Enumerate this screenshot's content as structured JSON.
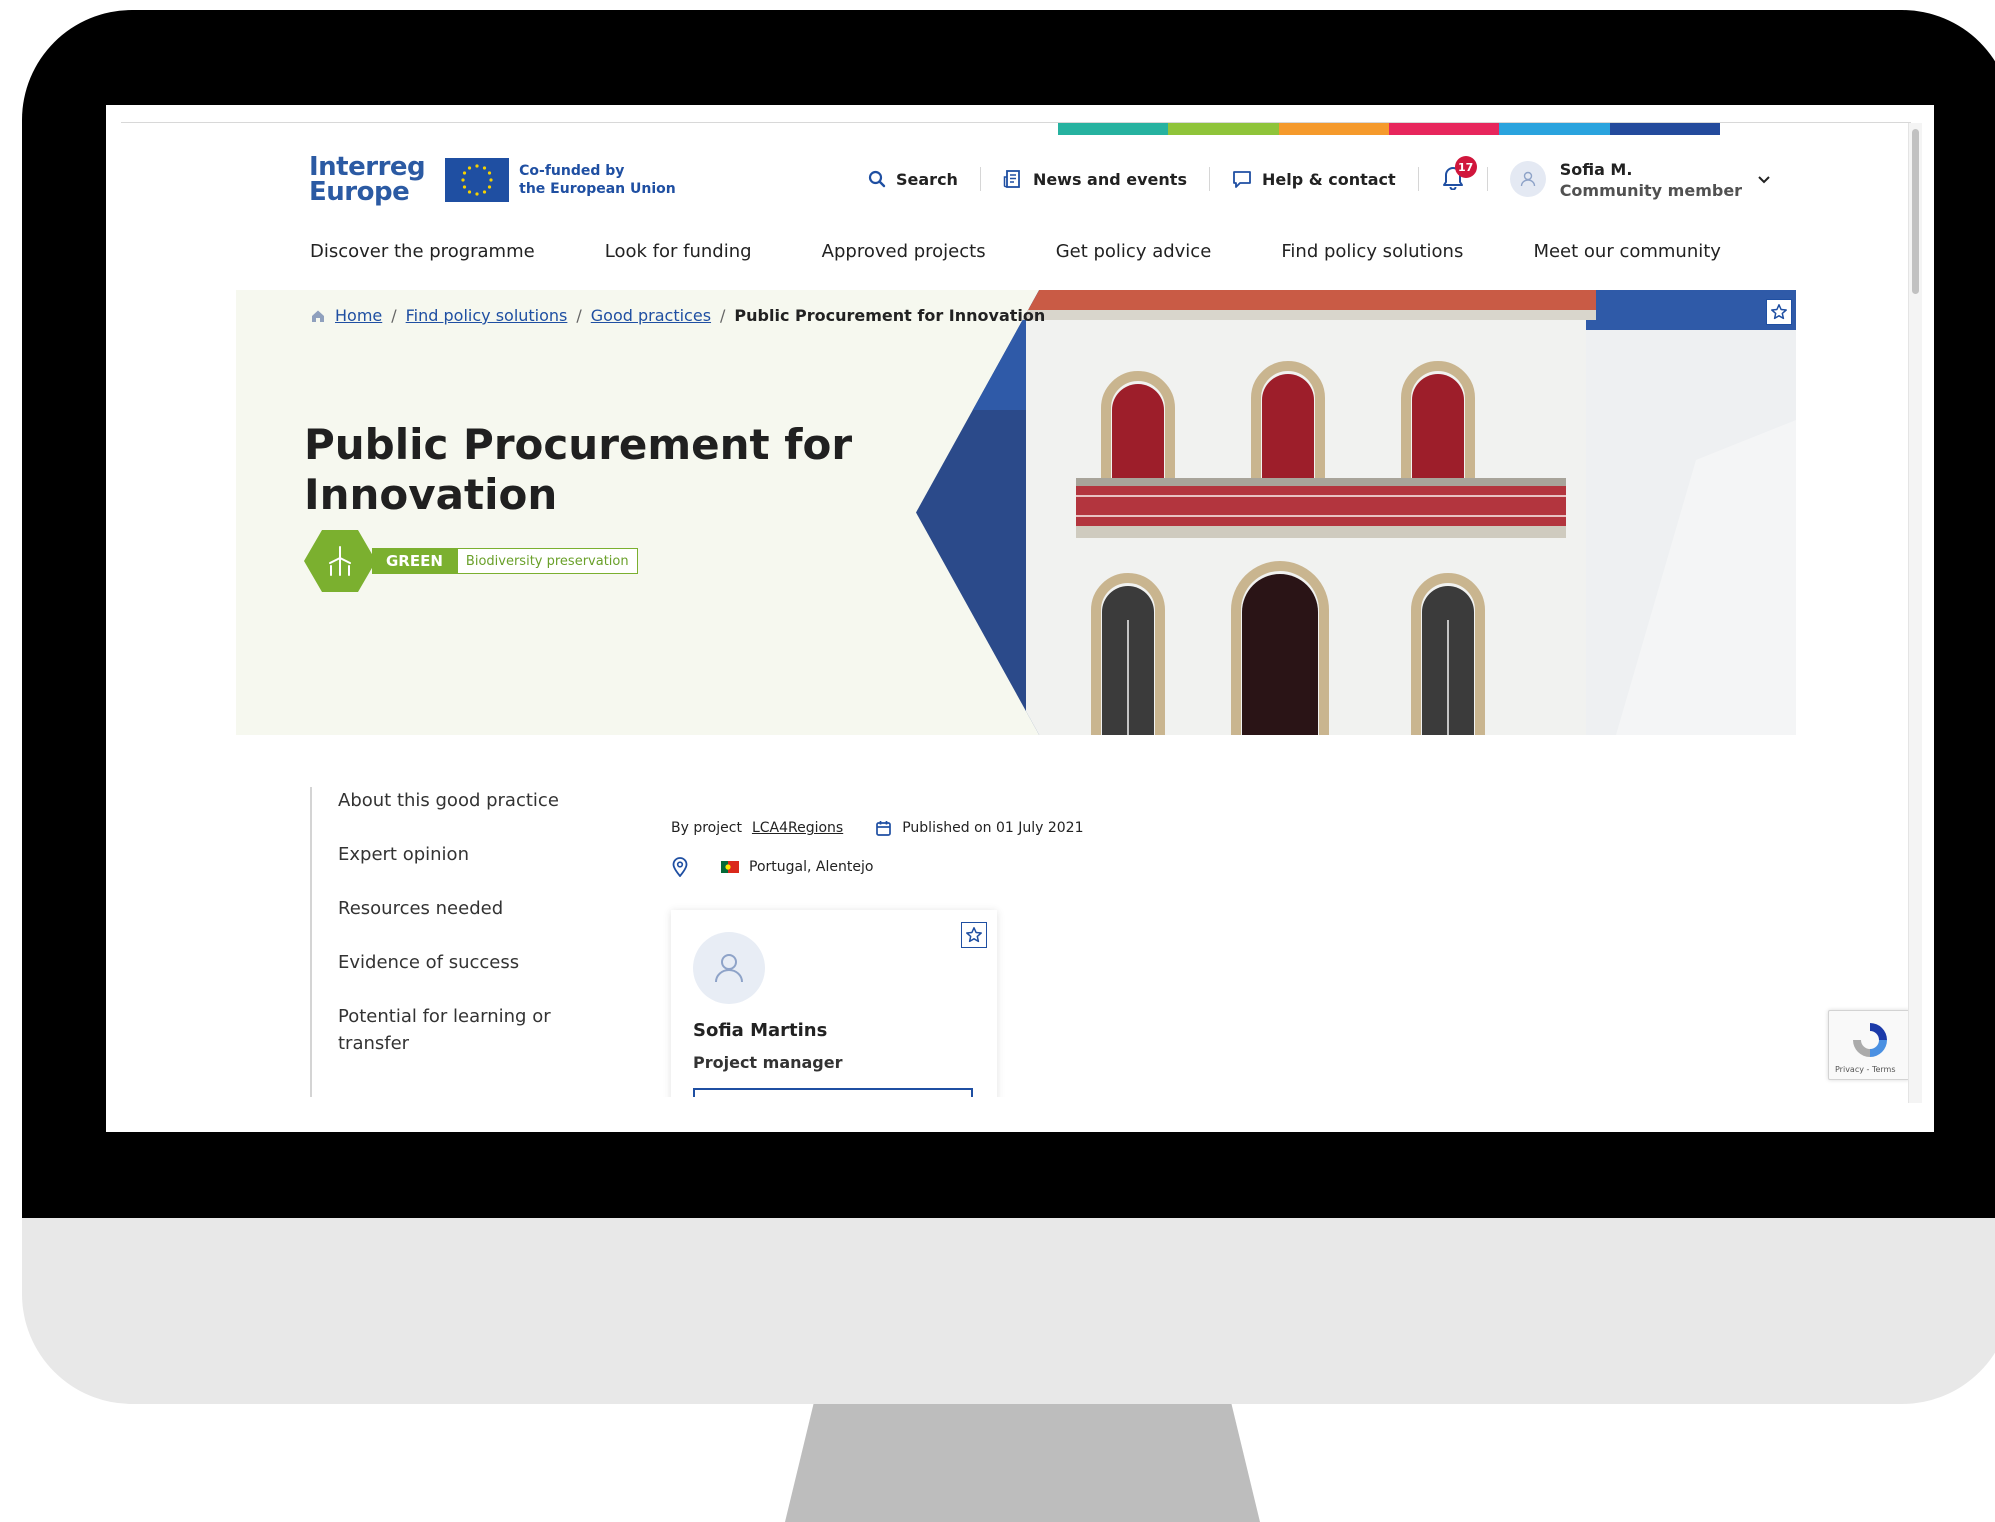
{
  "header": {
    "logo_line1": "Interreg",
    "logo_line2": "Europe",
    "eu_line1": "Co-funded by",
    "eu_line2": "the European Union",
    "search_label": "Search",
    "news_label": "News and events",
    "help_label": "Help & contact",
    "notification_count": "17",
    "user_name": "Sofia M.",
    "user_role": "Community member"
  },
  "color_strip": [
    "#26b2a0",
    "#8fc43a",
    "#f59a2c",
    "#e7265c",
    "#2aa3de",
    "#234a9c"
  ],
  "nav": [
    {
      "label": "Discover the programme"
    },
    {
      "label": "Look for funding"
    },
    {
      "label": "Approved projects"
    },
    {
      "label": "Get policy advice"
    },
    {
      "label": "Find policy solutions"
    },
    {
      "label": "Meet our community"
    }
  ],
  "breadcrumb": {
    "home": "Home",
    "level2": "Find policy solutions",
    "level3": "Good practices",
    "current": "Public Procurement for Innovation",
    "sep": "/"
  },
  "hero": {
    "title": "Public Procurement for Innovation",
    "tag_primary": "GREEN",
    "tag_secondary": "Biodiversity preservation"
  },
  "sidenav": [
    {
      "label": "About this good practice"
    },
    {
      "label": "Expert opinion"
    },
    {
      "label": "Resources needed"
    },
    {
      "label": "Evidence of success"
    },
    {
      "label": "Potential for learning or transfer"
    }
  ],
  "meta": {
    "by_project_label": "By project",
    "project_name": "LCA4Regions",
    "published": "Published on 01 July 2021",
    "location": "Portugal, Alentejo"
  },
  "contact_card": {
    "name": "Sofia Martins",
    "role": "Project manager"
  },
  "recaptcha": {
    "text": "Privacy - Terms"
  },
  "colors": {
    "brand_blue": "#1f4fa2",
    "green": "#7bb02f",
    "hero_bg": "#f6f8ef",
    "badge_red": "#d0163c"
  }
}
